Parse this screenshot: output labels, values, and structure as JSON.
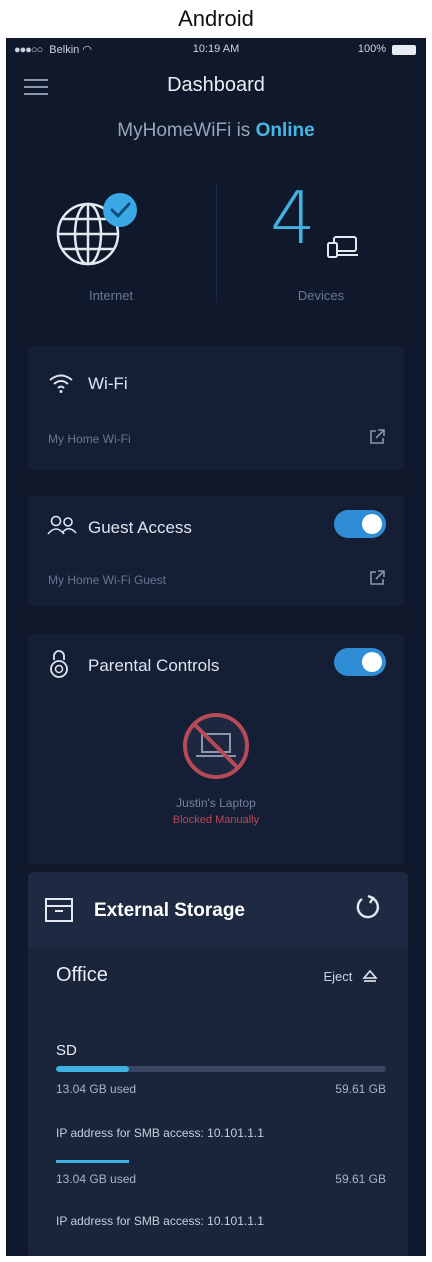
{
  "caption": "Android",
  "statusbar": {
    "carrier": "Belkin",
    "time": "10:19 AM",
    "battery": "100%"
  },
  "header": {
    "title": "Dashboard"
  },
  "network": {
    "name_prefix": "MyHomeWiFi is",
    "status": "Online"
  },
  "tiles": {
    "internet_label": "Internet",
    "devices_count": "4",
    "devices_label": "Devices"
  },
  "wifi": {
    "title": "Wi-Fi",
    "network": "My Home Wi-Fi"
  },
  "guest": {
    "title": "Guest Access",
    "network": "My Home Wi-Fi Guest",
    "enabled": true
  },
  "parental": {
    "title": "Parental Controls",
    "enabled": true,
    "device_name": "Justin's Laptop",
    "device_state": "Blocked Manually"
  },
  "storage": {
    "title": "External Storage",
    "location": "Office",
    "eject_label": "Eject",
    "drives": [
      {
        "name": "SD",
        "used": "13.04 GB used",
        "total": "59.61 GB",
        "fraction_used": 0.22,
        "ip": "IP address for SMB access: 10.101.1.1"
      },
      {
        "used": "13.04 GB used",
        "total": "59.61 GB",
        "fraction_used": 0.22,
        "ip": "IP address for SMB access: 10.101.1.1"
      }
    ]
  },
  "colors": {
    "background": "#10192c",
    "accent": "#3fb2e0",
    "toggle_on": "#2f8dd6",
    "blocked": "#b74a58"
  }
}
